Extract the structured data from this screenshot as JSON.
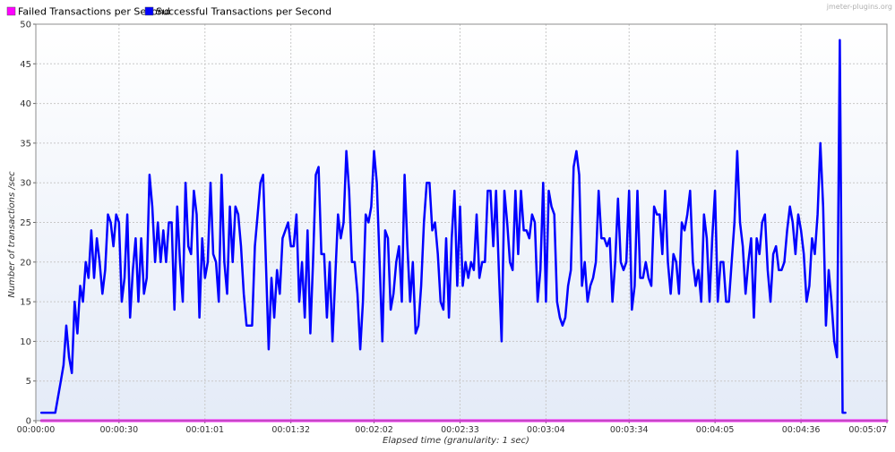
{
  "watermark": "jmeter-plugins.org",
  "chart_data": {
    "type": "line",
    "title": "",
    "xlabel": "Elapsed time (granularity: 1 sec)",
    "ylabel": "Number of transactions /sec",
    "ylim": [
      0,
      50
    ],
    "yticks": [
      0,
      5,
      10,
      15,
      20,
      25,
      30,
      35,
      40,
      45,
      50
    ],
    "xlim": [
      0,
      307
    ],
    "xticks": [
      {
        "t": 0,
        "label": "00:00:00"
      },
      {
        "t": 30,
        "label": "00:00:30"
      },
      {
        "t": 61,
        "label": "00:01:01"
      },
      {
        "t": 92,
        "label": "00:01:32"
      },
      {
        "t": 122,
        "label": "00:02:02"
      },
      {
        "t": 153,
        "label": "00:02:33"
      },
      {
        "t": 184,
        "label": "00:03:04"
      },
      {
        "t": 214,
        "label": "00:03:34"
      },
      {
        "t": 245,
        "label": "00:04:05"
      },
      {
        "t": 276,
        "label": "00:04:36"
      },
      {
        "t": 307,
        "label": "00:05:07"
      }
    ],
    "grid": true,
    "legend_position": "top-left",
    "series": [
      {
        "name": "Failed Transactions per Second",
        "color": "#ff00ff",
        "points": [
          [
            2,
            0
          ],
          [
            307,
            0
          ]
        ]
      },
      {
        "name": "Successful Transactions per Second",
        "color": "#0000ff",
        "points": [
          [
            2,
            1
          ],
          [
            6,
            1
          ],
          [
            7,
            1
          ],
          [
            8,
            3
          ],
          [
            9,
            5
          ],
          [
            10,
            7
          ],
          [
            11,
            12
          ],
          [
            12,
            8
          ],
          [
            13,
            6
          ],
          [
            14,
            15
          ],
          [
            15,
            11
          ],
          [
            16,
            17
          ],
          [
            17,
            15
          ],
          [
            18,
            20
          ],
          [
            19,
            18
          ],
          [
            20,
            24
          ],
          [
            21,
            18
          ],
          [
            22,
            23
          ],
          [
            23,
            20
          ],
          [
            24,
            16
          ],
          [
            25,
            19
          ],
          [
            26,
            26
          ],
          [
            27,
            25
          ],
          [
            28,
            22
          ],
          [
            29,
            26
          ],
          [
            30,
            25
          ],
          [
            31,
            15
          ],
          [
            32,
            18
          ],
          [
            33,
            26
          ],
          [
            34,
            13
          ],
          [
            35,
            19
          ],
          [
            36,
            23
          ],
          [
            37,
            15
          ],
          [
            38,
            23
          ],
          [
            39,
            16
          ],
          [
            40,
            18
          ],
          [
            41,
            31
          ],
          [
            42,
            27
          ],
          [
            43,
            20
          ],
          [
            44,
            25
          ],
          [
            45,
            20
          ],
          [
            46,
            24
          ],
          [
            47,
            20
          ],
          [
            48,
            25
          ],
          [
            49,
            25
          ],
          [
            50,
            14
          ],
          [
            51,
            27
          ],
          [
            52,
            20
          ],
          [
            53,
            15
          ],
          [
            54,
            30
          ],
          [
            55,
            22
          ],
          [
            56,
            21
          ],
          [
            57,
            29
          ],
          [
            58,
            26
          ],
          [
            59,
            13
          ],
          [
            60,
            23
          ],
          [
            61,
            18
          ],
          [
            62,
            20
          ],
          [
            63,
            30
          ],
          [
            64,
            21
          ],
          [
            65,
            20
          ],
          [
            66,
            15
          ],
          [
            67,
            31
          ],
          [
            68,
            20
          ],
          [
            69,
            16
          ],
          [
            70,
            27
          ],
          [
            71,
            20
          ],
          [
            72,
            27
          ],
          [
            73,
            26
          ],
          [
            74,
            22
          ],
          [
            75,
            16
          ],
          [
            76,
            12
          ],
          [
            77,
            12
          ],
          [
            78,
            12
          ],
          [
            79,
            22
          ],
          [
            80,
            26
          ],
          [
            81,
            30
          ],
          [
            82,
            31
          ],
          [
            83,
            20
          ],
          [
            84,
            9
          ],
          [
            85,
            18
          ],
          [
            86,
            13
          ],
          [
            87,
            19
          ],
          [
            88,
            16
          ],
          [
            89,
            23
          ],
          [
            90,
            24
          ],
          [
            91,
            25
          ],
          [
            92,
            22
          ],
          [
            93,
            22
          ],
          [
            94,
            26
          ],
          [
            95,
            15
          ],
          [
            96,
            20
          ],
          [
            97,
            13
          ],
          [
            98,
            24
          ],
          [
            99,
            11
          ],
          [
            100,
            20
          ],
          [
            101,
            31
          ],
          [
            102,
            32
          ],
          [
            103,
            21
          ],
          [
            104,
            21
          ],
          [
            105,
            13
          ],
          [
            106,
            20
          ],
          [
            107,
            10
          ],
          [
            108,
            18
          ],
          [
            109,
            26
          ],
          [
            110,
            23
          ],
          [
            111,
            25
          ],
          [
            112,
            34
          ],
          [
            113,
            29
          ],
          [
            114,
            20
          ],
          [
            115,
            20
          ],
          [
            116,
            16
          ],
          [
            117,
            9
          ],
          [
            118,
            15
          ],
          [
            119,
            26
          ],
          [
            120,
            25
          ],
          [
            121,
            27
          ],
          [
            122,
            34
          ],
          [
            123,
            30
          ],
          [
            124,
            20
          ],
          [
            125,
            10
          ],
          [
            126,
            24
          ],
          [
            127,
            23
          ],
          [
            128,
            14
          ],
          [
            129,
            16
          ],
          [
            130,
            20
          ],
          [
            131,
            22
          ],
          [
            132,
            15
          ],
          [
            133,
            31
          ],
          [
            134,
            22
          ],
          [
            135,
            15
          ],
          [
            136,
            20
          ],
          [
            137,
            11
          ],
          [
            138,
            12
          ],
          [
            139,
            17
          ],
          [
            140,
            25
          ],
          [
            141,
            30
          ],
          [
            142,
            30
          ],
          [
            143,
            24
          ],
          [
            144,
            25
          ],
          [
            145,
            21
          ],
          [
            146,
            15
          ],
          [
            147,
            14
          ],
          [
            148,
            23
          ],
          [
            149,
            13
          ],
          [
            150,
            23
          ],
          [
            151,
            29
          ],
          [
            152,
            17
          ],
          [
            153,
            27
          ],
          [
            154,
            17
          ],
          [
            155,
            20
          ],
          [
            156,
            18
          ],
          [
            157,
            20
          ],
          [
            158,
            19
          ],
          [
            159,
            26
          ],
          [
            160,
            18
          ],
          [
            161,
            20
          ],
          [
            162,
            20
          ],
          [
            163,
            29
          ],
          [
            164,
            29
          ],
          [
            165,
            22
          ],
          [
            166,
            29
          ],
          [
            167,
            19
          ],
          [
            168,
            10
          ],
          [
            169,
            29
          ],
          [
            170,
            25
          ],
          [
            171,
            20
          ],
          [
            172,
            19
          ],
          [
            173,
            29
          ],
          [
            174,
            21
          ],
          [
            175,
            29
          ],
          [
            176,
            24
          ],
          [
            177,
            24
          ],
          [
            178,
            23
          ],
          [
            179,
            26
          ],
          [
            180,
            25
          ],
          [
            181,
            15
          ],
          [
            182,
            19
          ],
          [
            183,
            30
          ],
          [
            184,
            15
          ],
          [
            185,
            29
          ],
          [
            186,
            27
          ],
          [
            187,
            26
          ],
          [
            188,
            15
          ],
          [
            189,
            13
          ],
          [
            190,
            12
          ],
          [
            191,
            13
          ],
          [
            192,
            17
          ],
          [
            193,
            19
          ],
          [
            194,
            32
          ],
          [
            195,
            34
          ],
          [
            196,
            31
          ],
          [
            197,
            17
          ],
          [
            198,
            20
          ],
          [
            199,
            15
          ],
          [
            200,
            17
          ],
          [
            201,
            18
          ],
          [
            202,
            20
          ],
          [
            203,
            29
          ],
          [
            204,
            23
          ],
          [
            205,
            23
          ],
          [
            206,
            22
          ],
          [
            207,
            23
          ],
          [
            208,
            15
          ],
          [
            209,
            20
          ],
          [
            210,
            28
          ],
          [
            211,
            20
          ],
          [
            212,
            19
          ],
          [
            213,
            20
          ],
          [
            214,
            29
          ],
          [
            215,
            14
          ],
          [
            216,
            17
          ],
          [
            217,
            29
          ],
          [
            218,
            18
          ],
          [
            219,
            18
          ],
          [
            220,
            20
          ],
          [
            221,
            18
          ],
          [
            222,
            17
          ],
          [
            223,
            27
          ],
          [
            224,
            26
          ],
          [
            225,
            26
          ],
          [
            226,
            21
          ],
          [
            227,
            29
          ],
          [
            228,
            20
          ],
          [
            229,
            16
          ],
          [
            230,
            21
          ],
          [
            231,
            20
          ],
          [
            232,
            16
          ],
          [
            233,
            25
          ],
          [
            234,
            24
          ],
          [
            235,
            26
          ],
          [
            236,
            29
          ],
          [
            237,
            20
          ],
          [
            238,
            17
          ],
          [
            239,
            19
          ],
          [
            240,
            15
          ],
          [
            241,
            26
          ],
          [
            242,
            23
          ],
          [
            243,
            15
          ],
          [
            244,
            23
          ],
          [
            245,
            29
          ],
          [
            246,
            15
          ],
          [
            247,
            20
          ],
          [
            248,
            20
          ],
          [
            249,
            15
          ],
          [
            250,
            15
          ],
          [
            251,
            20
          ],
          [
            252,
            25
          ],
          [
            253,
            34
          ],
          [
            254,
            25
          ],
          [
            255,
            22
          ],
          [
            256,
            16
          ],
          [
            257,
            20
          ],
          [
            258,
            23
          ],
          [
            259,
            13
          ],
          [
            260,
            23
          ],
          [
            261,
            21
          ],
          [
            262,
            25
          ],
          [
            263,
            26
          ],
          [
            264,
            19
          ],
          [
            265,
            15
          ],
          [
            266,
            21
          ],
          [
            267,
            22
          ],
          [
            268,
            19
          ],
          [
            269,
            19
          ],
          [
            270,
            20
          ],
          [
            271,
            24
          ],
          [
            272,
            27
          ],
          [
            273,
            25
          ],
          [
            274,
            21
          ],
          [
            275,
            26
          ],
          [
            276,
            24
          ],
          [
            277,
            21
          ],
          [
            278,
            15
          ],
          [
            279,
            17
          ],
          [
            280,
            23
          ],
          [
            281,
            21
          ],
          [
            282,
            26
          ],
          [
            283,
            35
          ],
          [
            284,
            27
          ],
          [
            285,
            12
          ],
          [
            286,
            19
          ],
          [
            287,
            15
          ],
          [
            288,
            10
          ],
          [
            289,
            8
          ],
          [
            290,
            48
          ],
          [
            291,
            1
          ],
          [
            292,
            1
          ]
        ]
      }
    ]
  }
}
